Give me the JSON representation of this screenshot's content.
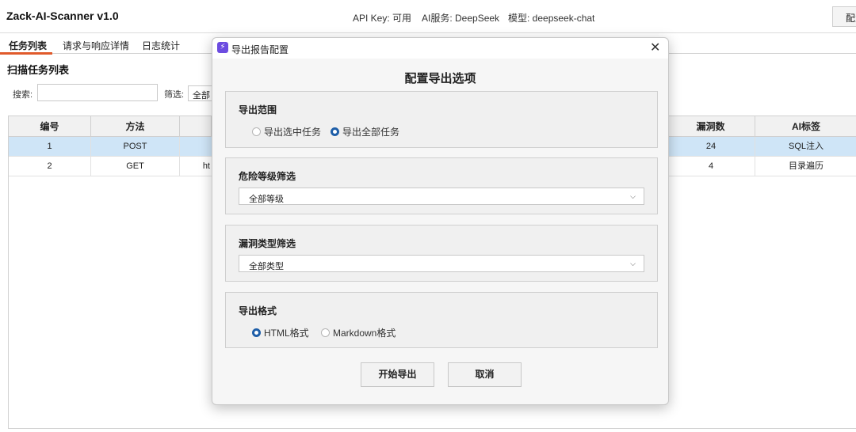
{
  "app": {
    "title": "Zack-AI-Scanner v1.0",
    "api_key_status": "API Key: 可用",
    "ai_service": "AI服务: DeepSeek",
    "model": "模型: deepseek-chat",
    "config_button": "配置"
  },
  "tabs": [
    {
      "label": "任务列表",
      "active": true
    },
    {
      "label": "请求与响应详情",
      "active": false
    },
    {
      "label": "日志统计",
      "active": false
    }
  ],
  "main": {
    "section_title": "扫描任务列表",
    "search_label": "搜索:",
    "search_value": "",
    "filter_label": "筛选:",
    "filter_value": "全部"
  },
  "table": {
    "columns": [
      "编号",
      "方法",
      "漏洞数",
      "AI标签"
    ],
    "rows": [
      {
        "id": "1",
        "method": "POST",
        "url_fragment": "",
        "vulns": "24",
        "ai_tag": "SQL注入",
        "selected": true
      },
      {
        "id": "2",
        "method": "GET",
        "url_fragment": "ht",
        "vulns": "4",
        "ai_tag": "目录遍历",
        "selected": false
      }
    ]
  },
  "dialog": {
    "icon": "⚡",
    "title": "导出报告配置",
    "heading": "配置导出选项",
    "scope": {
      "title": "导出范围",
      "options": [
        "导出选中任务",
        "导出全部任务"
      ],
      "selected": 1
    },
    "severity": {
      "title": "危险等级筛选",
      "value": "全部等级"
    },
    "vuln_type": {
      "title": "漏洞类型筛选",
      "value": "全部类型"
    },
    "format": {
      "title": "导出格式",
      "options": [
        "HTML格式",
        "Markdown格式"
      ],
      "selected": 0
    },
    "start_button": "开始导出",
    "cancel_button": "取消"
  },
  "colors": {
    "accent_tab": "#e05a2b",
    "radio_checked": "#1e5ea8",
    "row_selected": "#cfe5f7",
    "dialog_icon": "#6c4ce0"
  }
}
